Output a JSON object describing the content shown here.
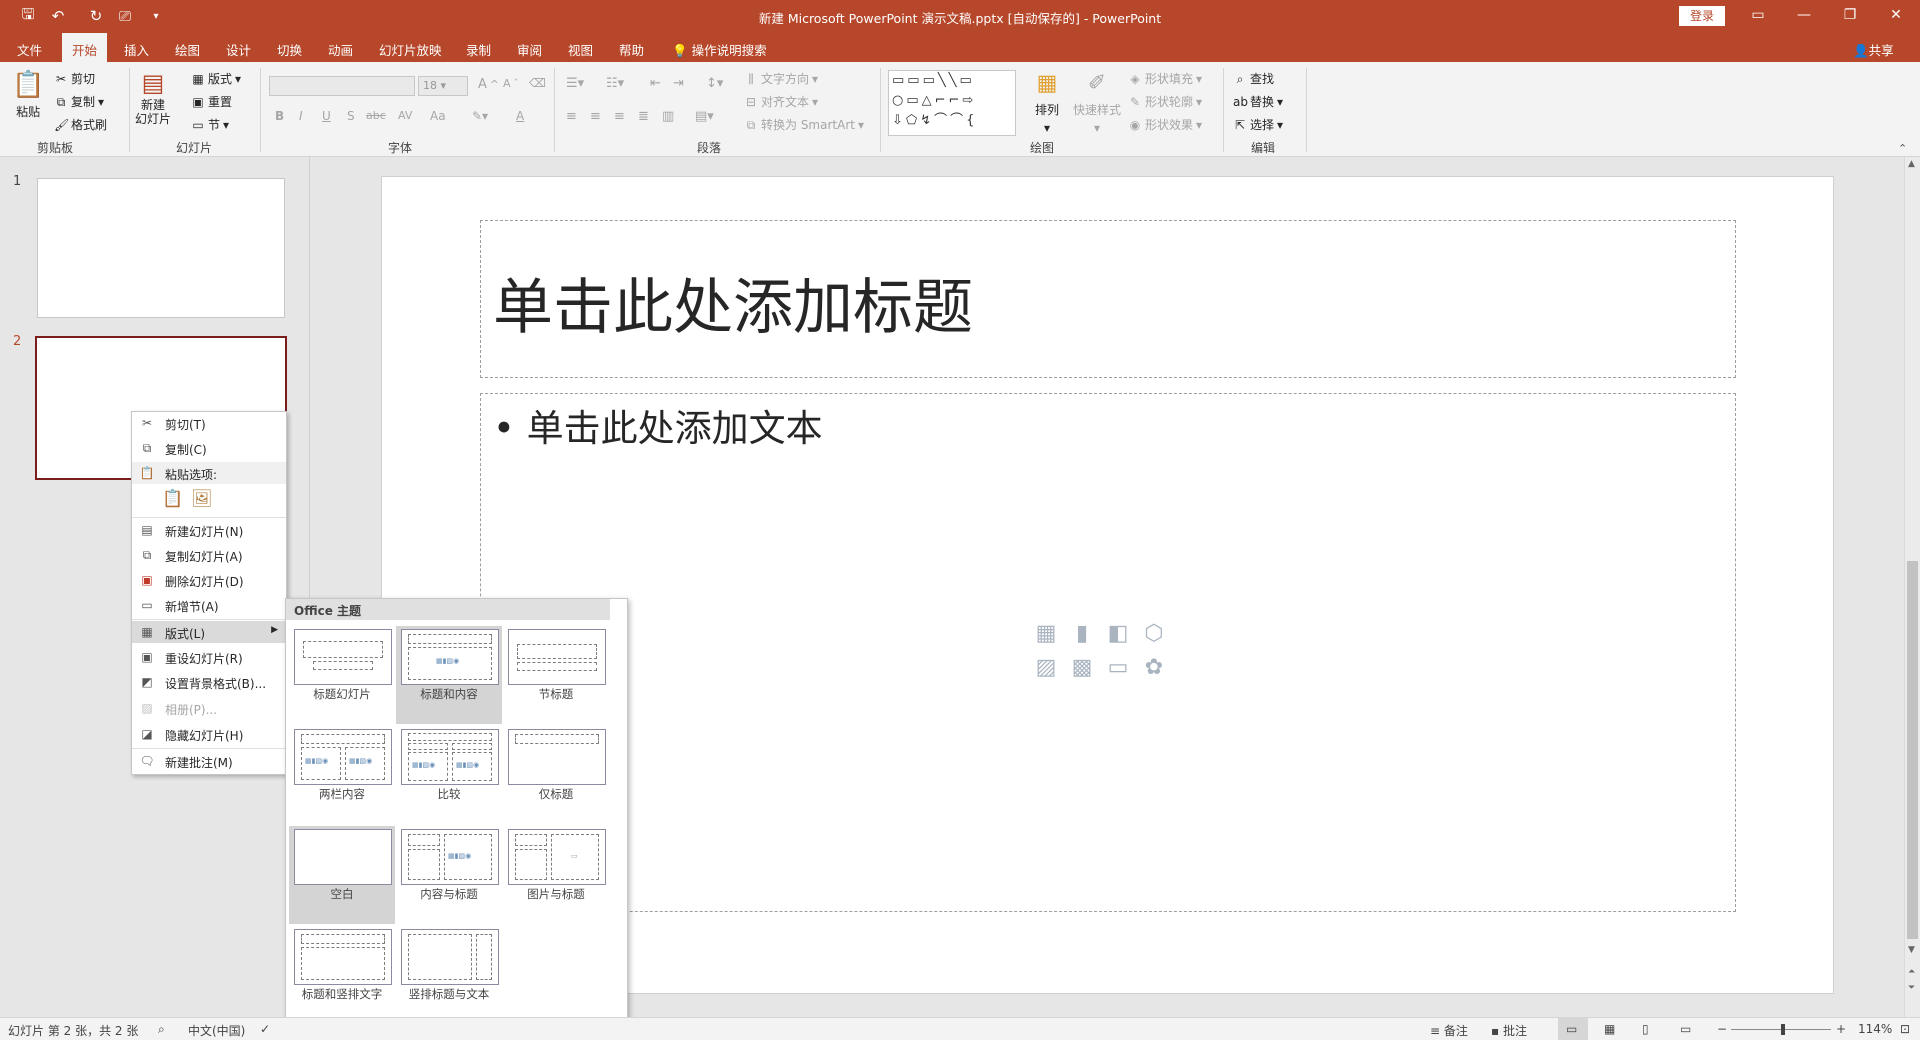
{
  "titlebar": {
    "doc_title": "新建 Microsoft PowerPoint 演示文稿.pptx [自动保存的] - PowerPoint",
    "login": "登录",
    "quick_access": [
      "save-icon",
      "undo-icon",
      "redo-icon",
      "presentation-icon",
      "customize-icon"
    ]
  },
  "tabs": [
    "文件",
    "开始",
    "插入",
    "绘图",
    "设计",
    "切换",
    "动画",
    "幻灯片放映",
    "录制",
    "审阅",
    "视图",
    "帮助"
  ],
  "tell_me": "操作说明搜索",
  "share": "共享",
  "ribbon": {
    "clipboard": {
      "label": "剪贴板",
      "paste": "粘贴",
      "cut": "剪切",
      "copy": "复制",
      "format_painter": "格式刷"
    },
    "slides": {
      "label": "幻灯片",
      "new_slide_1": "新建",
      "new_slide_2": "幻灯片",
      "layout": "版式",
      "reset": "重置",
      "section": "节"
    },
    "font": {
      "label": "字体",
      "font_size": "18",
      "bold": "B",
      "italic": "I",
      "underline": "U",
      "shadow": "S",
      "strike": "abc",
      "spacing": "AV",
      "case": "Aa",
      "color": "A",
      "grow": "A",
      "shrink": "A"
    },
    "paragraph": {
      "label": "段落",
      "text_direction": "文字方向",
      "align_text": "对齐文本",
      "smartart": "转换为 SmartArt"
    },
    "drawing": {
      "label": "绘图",
      "arrange": "排列",
      "quick_styles": "快速样式",
      "shape_fill": "形状填充",
      "shape_outline": "形状轮廓",
      "shape_effects": "形状效果"
    },
    "editing": {
      "label": "编辑",
      "find": "查找",
      "replace": "替换",
      "select": "选择"
    }
  },
  "slides_panel": [
    {
      "num": "1"
    },
    {
      "num": "2"
    }
  ],
  "slide": {
    "title_placeholder": "单击此处添加标题",
    "body_placeholder": "单击此处添加文本"
  },
  "context_menu": {
    "items": [
      {
        "label": "剪切(T)",
        "icon": "scissors-icon",
        "enabled": true
      },
      {
        "label": "复制(C)",
        "icon": "copy-icon",
        "enabled": true
      },
      {
        "label": "粘贴选项:",
        "icon": "paste-icon",
        "enabled": true
      },
      {
        "label": "新建幻灯片(N)",
        "icon": "new-slide-icon",
        "enabled": true
      },
      {
        "label": "复制幻灯片(A)",
        "icon": "duplicate-slide-icon",
        "enabled": true
      },
      {
        "label": "删除幻灯片(D)",
        "icon": "delete-slide-icon",
        "enabled": true
      },
      {
        "label": "新增节(A)",
        "icon": "add-section-icon",
        "enabled": true
      },
      {
        "label": "版式(L)",
        "icon": "layout-icon",
        "enabled": true
      },
      {
        "label": "重设幻灯片(R)",
        "icon": "reset-slide-icon",
        "enabled": true
      },
      {
        "label": "设置背景格式(B)...",
        "icon": "format-background-icon",
        "enabled": true
      },
      {
        "label": "相册(P)...",
        "icon": "photo-album-icon",
        "enabled": false
      },
      {
        "label": "隐藏幻灯片(H)",
        "icon": "hide-slide-icon",
        "enabled": true
      },
      {
        "label": "新建批注(M)",
        "icon": "new-comment-icon",
        "enabled": true
      }
    ]
  },
  "layout_flyout": {
    "header": "Office 主题",
    "layouts": [
      "标题幻灯片",
      "标题和内容",
      "节标题",
      "两栏内容",
      "比较",
      "仅标题",
      "空白",
      "内容与标题",
      "图片与标题",
      "标题和竖排文字",
      "竖排标题与文本"
    ],
    "selected": "标题和内容"
  },
  "statusbar": {
    "slide_info": "幻灯片 第 2 张，共 2 张",
    "language": "中文(中国)",
    "notes": "备注",
    "comments": "批注",
    "zoom": "114%"
  }
}
